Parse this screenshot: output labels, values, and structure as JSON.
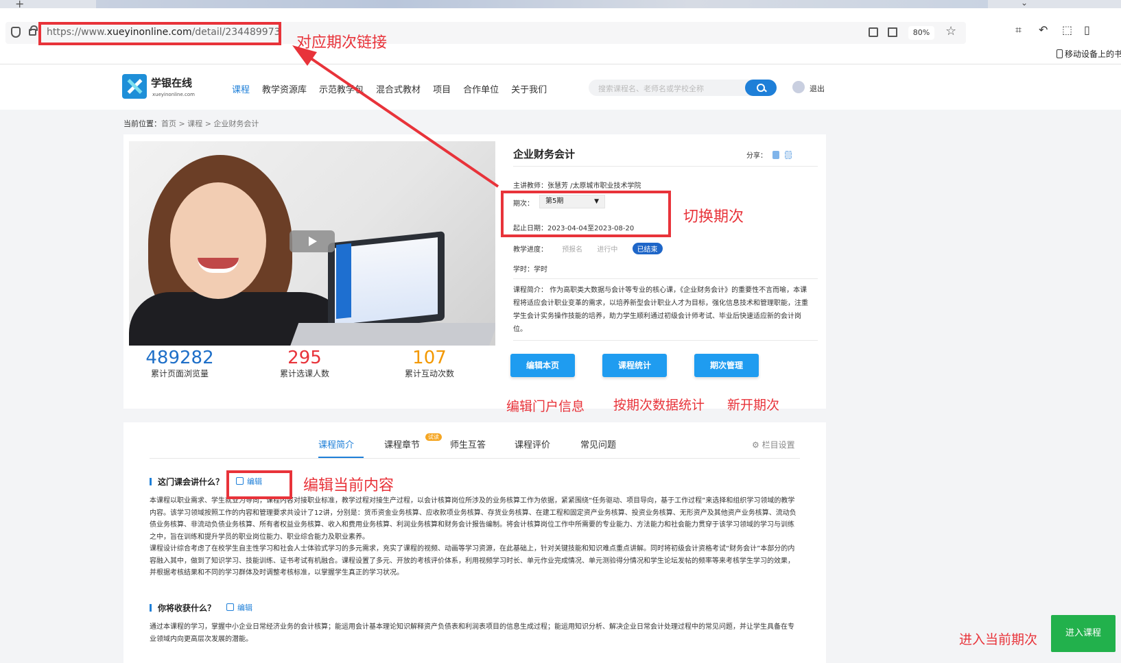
{
  "browser": {
    "url_prefix": "https://www.",
    "url_domain": "xueyinonline.com",
    "url_path": "/detail/234489973",
    "zoom": "80%",
    "bookmark_folder": "移动设备上的书"
  },
  "header": {
    "logo_text": "学银在线",
    "logo_sub": "xueyinonline.com",
    "nav": [
      "课程",
      "教学资源库",
      "示范教学包",
      "混合式教材",
      "项目",
      "合作单位",
      "关于我们"
    ],
    "search_placeholder": "搜索课程名、老师名或学校全称",
    "logout": "退出"
  },
  "breadcrumb": {
    "label": "当前位置：",
    "path": "首页 > 课程 > 企业财务会计"
  },
  "course": {
    "title": "企业财务会计",
    "share_label": "分享：",
    "teacher": "主讲教师：张慧芳 /太原城市职业技术学院",
    "term_label": "期次：",
    "term_value": "第5期",
    "dates": "起止日期：2023-04-04至2023-08-20",
    "progress_label": "教学进度：",
    "progress": [
      "预报名",
      "进行中",
      "已结束"
    ],
    "hours": "学时：学时",
    "intro": "课程简介： 作为高职类大数据与会计等专业的核心课，《企业财务会计》的重要性不言而喻，本课程将适应会计职业变革的需求，以培养新型会计职业人才为目标，强化信息技术和管理职能，注重学生会计实务操作技能的培养，助力学生顺利通过初级会计师考试、毕业后快速适应新的会计岗位。"
  },
  "stats": [
    {
      "value": "489282",
      "label": "累计页面浏览量",
      "color": "#1e6fc8"
    },
    {
      "value": "295",
      "label": "累计选课人数",
      "color": "#e8333a"
    },
    {
      "value": "107",
      "label": "累计互动次数",
      "color": "#f39800"
    }
  ],
  "actions": [
    "编辑本页",
    "课程统计",
    "期次管理"
  ],
  "tabs": {
    "items": [
      "课程简介",
      "课程章节",
      "师生互答",
      "课程评价",
      "常见问题"
    ],
    "trial_badge": "试读",
    "column_settings": "栏目设置"
  },
  "content": {
    "q1": "这门课会讲什么？",
    "edit": "编辑",
    "p1": "本课程以职业需求、学生就业为导向，课程内容对接职业标准，教学过程对接生产过程，以会计核算岗位所涉及的业务核算工作为依据，紧紧围绕“任务驱动、项目导向，基于工作过程”来选择和组织学习领域的教学内容。该学习领域按照工作的内容和管理要求共设计了12讲，分别是：货币资金业务核算、应收款项业务核算、存货业务核算、在建工程和固定资产业务核算、投资业务核算、无形资产及其他资产业务核算、流动负债业务核算、非流动负债业务核算、所有者权益业务核算、收入和费用业务核算、利润业务核算和财务会计报告编制。将会计核算岗位工作中所需要的专业能力、方法能力和社会能力贯穿于该学习领域的学习与训练之中，旨在训练和提升学员的职业岗位能力、职业综合能力及职业素养。",
    "p2": "课程设计综合考虑了在校学生自主性学习和社会人士体验式学习的多元需求，充实了课程的视频、动画等学习资源，在此基础上，针对关键技能和知识难点重点讲解。同时将初级会计资格考试“财务会计”本部分的内容融入其中，做到了知识学习、技能训练、证书考试有机融合。课程设置了多元、开放的考核评价体系，利用视频学习时长、单元作业完成情况、单元测验得分情况和学生论坛发帖的频率等来考核学生学习的效果，并根据考核结果和不同的学习群体及时调整考核标准，以掌握学生真正的学习状况。",
    "q2": "你将收获什么？",
    "p3": " 通过本课程的学习，掌握中小企业日常经济业务的会计核算；能运用会计基本理论知识解释资产负债表和利润表项目的信息生成过程；能运用知识分析、解决企业日常会计处理过程中的常见问题，并让学生具备在专业领域内向更高层次发展的潜能。"
  },
  "annotations": {
    "link": "对应期次链接",
    "switch": "切换期次",
    "edit_portal": "编辑门户信息",
    "stats_by_term": "按期次数据统计",
    "new_term": "新开期次",
    "edit_current": "编辑当前内容",
    "enter_current": "进入当前期次",
    "enter_button": "进入课程"
  }
}
